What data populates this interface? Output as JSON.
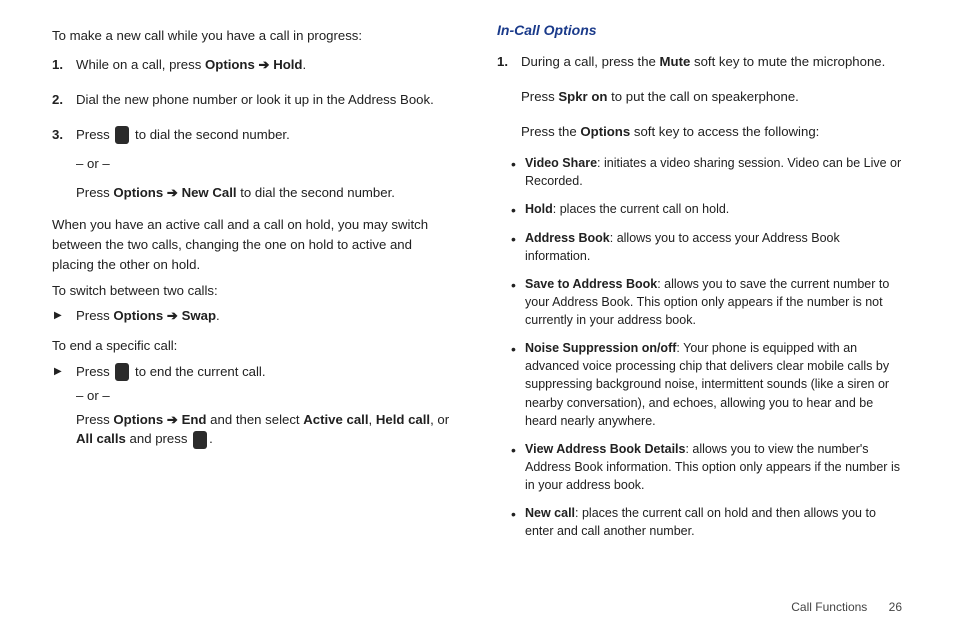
{
  "left": {
    "intro": "To make a new call while you have a call in progress:",
    "step1_a": "While on a call, press ",
    "step1_b": "Options ➔ Hold",
    "step1_c": ".",
    "step2": "Dial the new phone number or look it up in the Address Book.",
    "step3_a": "Press ",
    "step3_b": " to dial the second number.",
    "step3_or": "– or –",
    "step3_c": "Press ",
    "step3_d": "Options ➔ New Call",
    "step3_e": " to dial the second number.",
    "switch_intro": "When you have an active call and a call on hold, you may switch between the two calls, changing the one on hold to active and placing the other on hold.",
    "switch_label": "To switch between two calls:",
    "swap_a": "Press ",
    "swap_b": "Options ➔ Swap",
    "swap_c": ".",
    "end_label": "To end a specific call:",
    "end1_a": "Press ",
    "end1_b": " to end the current call.",
    "end_or": "– or –",
    "end2_a": "Press ",
    "end2_b": "Options ➔ End",
    "end2_c": " and then select ",
    "end2_d": "Active call",
    "end2_e": ", ",
    "end2_f": "Held call",
    "end2_g": ", or ",
    "end2_h": "All calls",
    "end2_i": " and press ",
    "end2_j": "."
  },
  "right": {
    "header": "In-Call Options",
    "step1_a": "During a call, press the ",
    "step1_b": "Mute",
    "step1_c": " soft key to mute the microphone.",
    "spkr_a": "Press ",
    "spkr_b": "Spkr on",
    "spkr_c": " to put the call on speakerphone.",
    "opt_a": "Press the ",
    "opt_b": "Options",
    "opt_c": " soft key to access the following:",
    "b1_t": "Video Share",
    "b1_d": ": initiates a video sharing session. Video can be Live or Recorded.",
    "b2_t": "Hold",
    "b2_d": ": places the current call on hold.",
    "b3_t": "Address Book",
    "b3_d": ": allows you to access your Address Book information.",
    "b4_t": "Save to Address Book",
    "b4_d": ": allows you to save the current number to your Address Book. This option only appears if the number is not currently in your address book.",
    "b5_t": "Noise Suppression on/off",
    "b5_d": ": Your phone is equipped with an advanced voice processing chip that delivers clear mobile calls by suppressing background noise, intermittent sounds (like a siren or nearby conversation), and echoes, allowing you to hear and be heard nearly anywhere.",
    "b6_t": "View Address Book Details",
    "b6_d": ": allows you to view the number's Address Book information. This option only appears if the number is in your address book.",
    "b7_t": "New call",
    "b7_d": ": places the current call on hold and then allows you to enter and call another number."
  },
  "footer": {
    "section": "Call Functions",
    "page": "26"
  }
}
